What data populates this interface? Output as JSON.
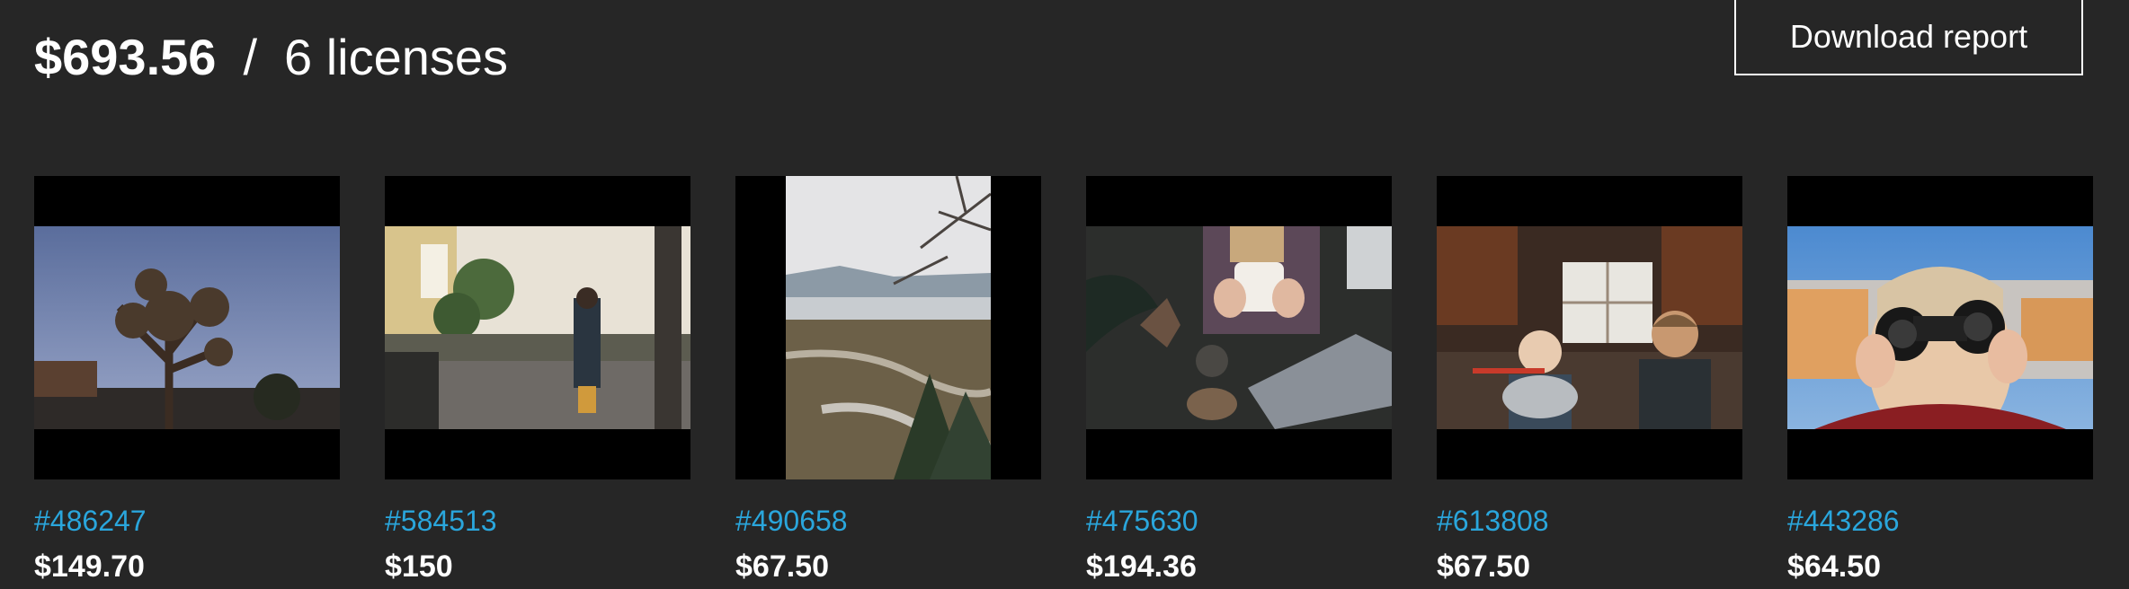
{
  "summary": {
    "total": "$693.56",
    "separator": "/",
    "licenses": "6 licenses"
  },
  "toolbar": {
    "download_label": "Download report"
  },
  "colors": {
    "background": "#262626",
    "link": "#2aa6dc",
    "text": "#ffffff"
  },
  "items": [
    {
      "id": "#486247",
      "price": "$149.70",
      "photo": "joshua-tree-at-dusk"
    },
    {
      "id": "#584513",
      "price": "$150",
      "photo": "person-on-porch"
    },
    {
      "id": "#490658",
      "price": "$67.50",
      "photo": "winter-valley-view"
    },
    {
      "id": "#475630",
      "price": "$194.36",
      "photo": "hands-holding-mug"
    },
    {
      "id": "#613808",
      "price": "$67.50",
      "photo": "kids-in-kitchen"
    },
    {
      "id": "#443286",
      "price": "$64.50",
      "photo": "child-with-binoculars"
    }
  ]
}
